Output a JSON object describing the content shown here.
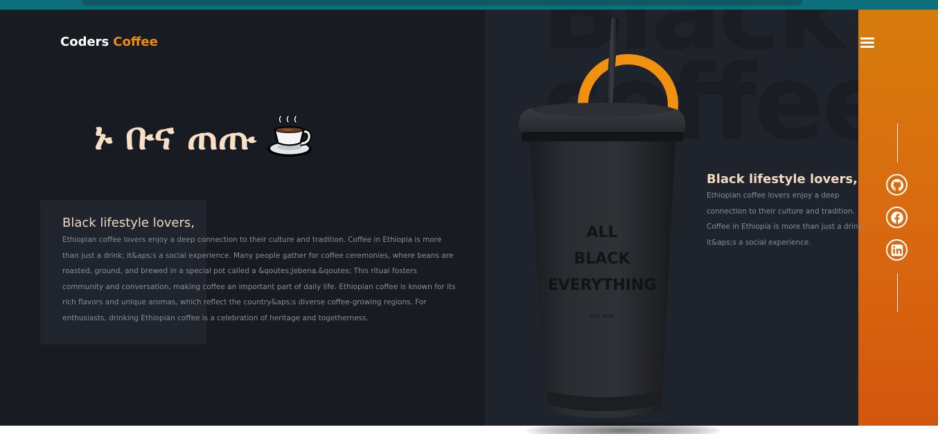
{
  "header": {
    "brand_primary": "Coders",
    "brand_secondary": "Coffee",
    "menu_icon": "hamburger-menu-icon"
  },
  "hero": {
    "title": "ኑ ቡና ጠጡ",
    "emoji_icon": "hot-coffee-cup-icon"
  },
  "intro_card": {
    "heading": "Black lifestyle lovers,",
    "body": "Ethiopian coffee lovers enjoy a deep connection to their culture and tradition. Coffee in Ethiopia is more than just a drink; it&aps;s a social experience. Many people gather for coffee ceremonies, where beans are roasted, ground, and brewed in a special pot called a &qoutes;Jebena.&qoutes; This ritual fosters community and conversation, making coffee an important part of daily life. Ethiopian coffee is known for its rich flavors and unique aromas, which reflect the country&aps;s diverse coffee-growing regions. For enthusiasts, drinking Ethiopian coffee is a celebration of heritage and togetherness."
  },
  "background_words": {
    "line1": "Black",
    "line2": "coffee"
  },
  "product": {
    "line1": "ALL",
    "line2": "BLACK",
    "line3": "EVERYTHING",
    "established": "EST. 2018"
  },
  "side_card": {
    "heading": "Black lifestyle lovers,",
    "body": "Ethiopian coffee lovers enjoy a deep connection to their culture and tradition. Coffee in Ethiopia is more than just a drink; it&aps;s a social experience."
  },
  "social": {
    "items": [
      "github-icon",
      "facebook-icon",
      "linkedin-icon"
    ]
  },
  "colors": {
    "accent": "#f08a12",
    "page_background": "#181c22",
    "panel_background": "#1f232b",
    "sidebar_orange": "#d96a10",
    "heading_text": "#efd9c2",
    "body_text": "#888d96"
  }
}
